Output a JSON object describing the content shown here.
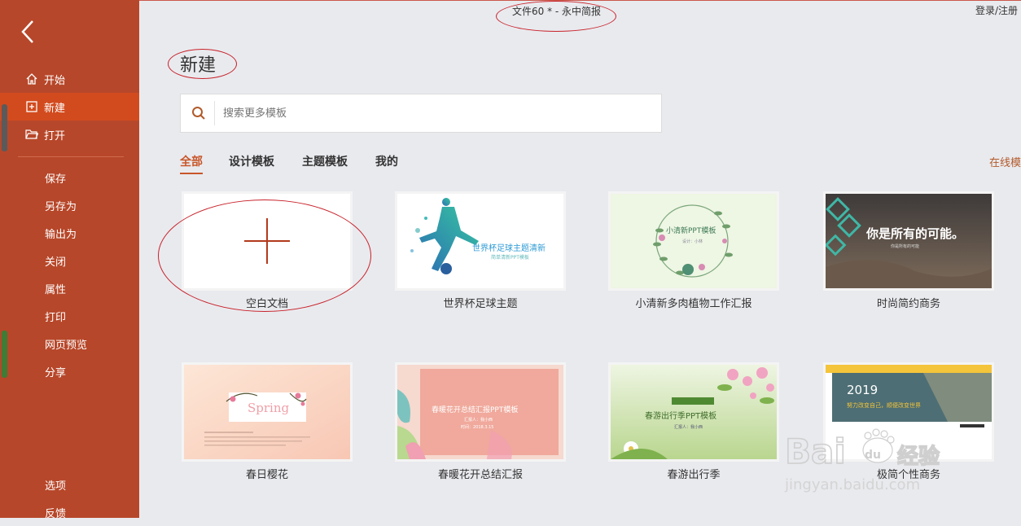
{
  "window": {
    "title": "文件60 * - 永中简报",
    "login": "登录/注册"
  },
  "sidebar": {
    "top_items": [
      {
        "label": "开始",
        "icon": "home-icon"
      },
      {
        "label": "新建",
        "icon": "new-file-icon",
        "active": true
      },
      {
        "label": "打开",
        "icon": "folder-open-icon"
      }
    ],
    "items": [
      "保存",
      "另存为",
      "输出为",
      "关闭",
      "属性",
      "打印",
      "网页预览",
      "分享"
    ],
    "bottom_items": [
      "选项",
      "反馈"
    ]
  },
  "main": {
    "heading": "新建",
    "search": {
      "placeholder": "搜索更多模板",
      "value": ""
    },
    "tabs": [
      "全部",
      "设计模板",
      "主题模板",
      "我的"
    ],
    "online_link": "在线模板",
    "templates": [
      {
        "label": "空白文档"
      },
      {
        "label": "世界杯足球主题",
        "thumb_text": [
          "世界杯足球主题清新",
          "简单清新PPT模板"
        ]
      },
      {
        "label": "小清新多肉植物工作汇报",
        "thumb_text": [
          "小清新PPT模板",
          "设计：小林"
        ]
      },
      {
        "label": "时尚简约商务",
        "thumb_text": [
          "你是所有的可能。",
          "你是所有的可能"
        ]
      },
      {
        "label": "春日樱花",
        "thumb_text": [
          "Spring"
        ]
      },
      {
        "label": "春暖花开总结汇报",
        "thumb_text": [
          "春暖花开总结汇报PPT模板",
          "汇报人：我小西",
          "时间：2018.3.15"
        ]
      },
      {
        "label": "春游出行季",
        "thumb_text": [
          "春游出行季PPT模板",
          "汇报人：我小西"
        ]
      },
      {
        "label": "极简个性商务",
        "thumb_text": [
          "2019",
          "努力改变自己，顺便改变世界"
        ]
      }
    ]
  },
  "watermark": {
    "brand": "Bai",
    "brand2": "du",
    "product": "经验",
    "url": "jingyan.baidu.com"
  },
  "colors": {
    "sidebar": "#b7472a",
    "active": "#d24b1e",
    "accent": "#c8562a",
    "annotation": "#c8222a"
  }
}
